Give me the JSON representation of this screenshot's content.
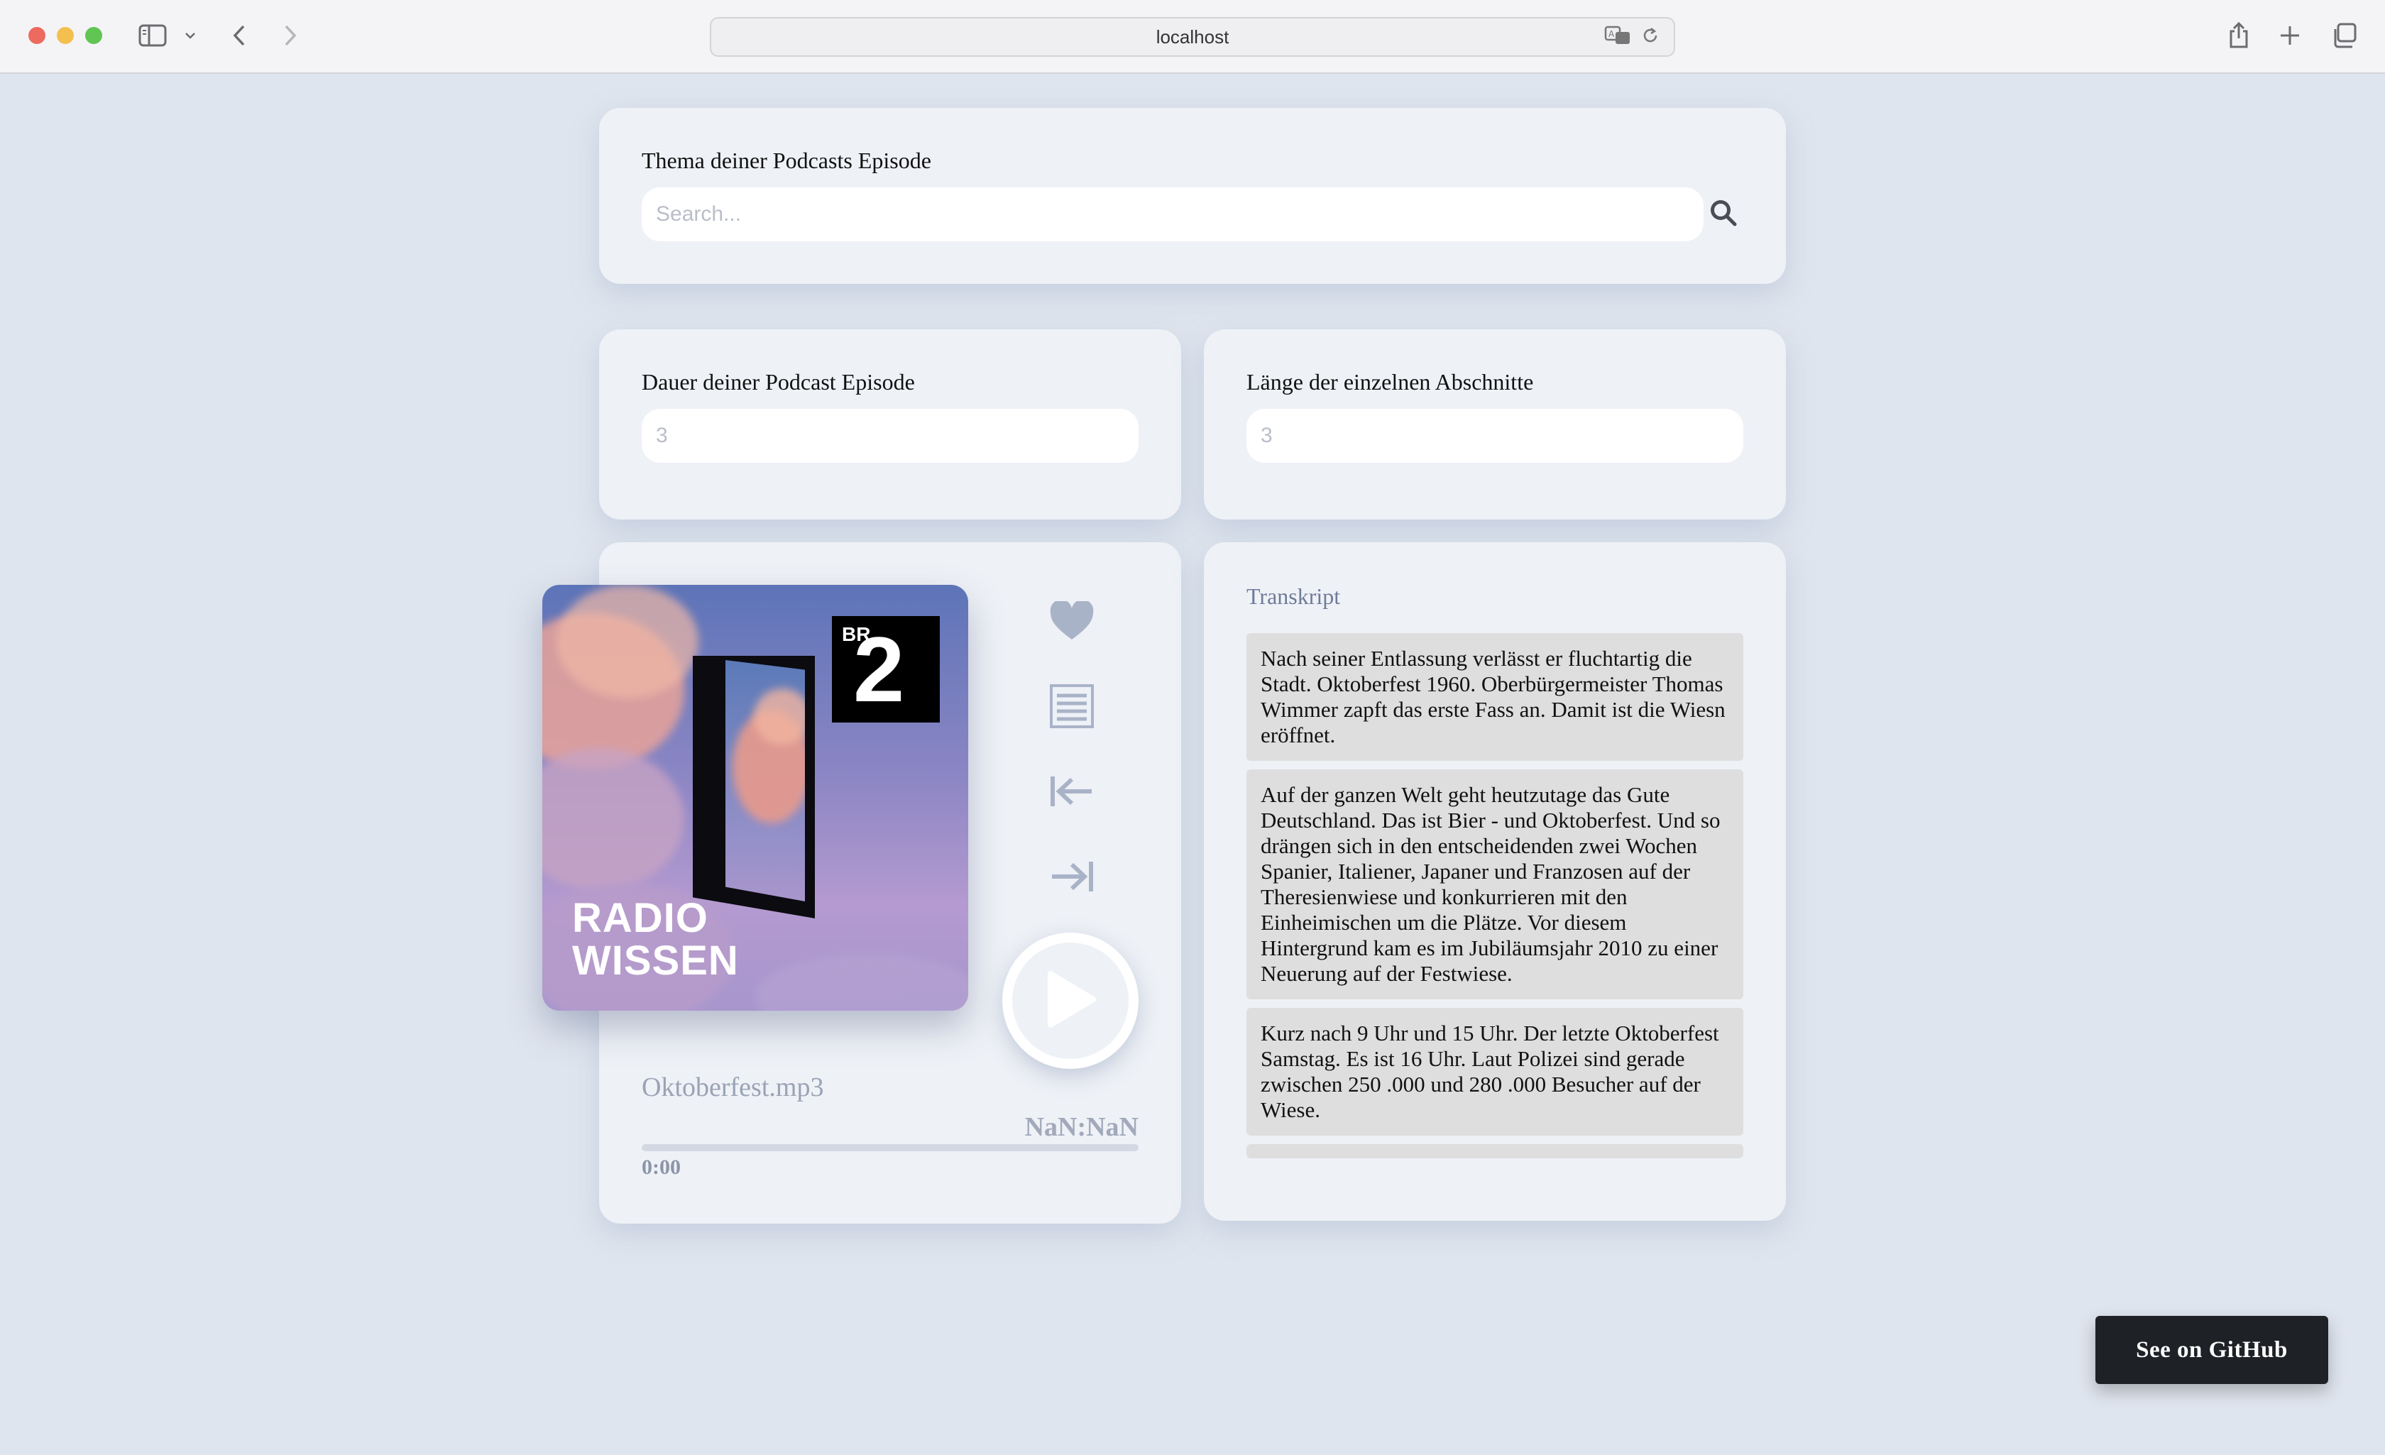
{
  "browser": {
    "url": "localhost"
  },
  "search": {
    "label": "Thema deiner Podcasts Episode",
    "placeholder": "Search..."
  },
  "duration": {
    "label": "Dauer deiner Podcast Episode",
    "placeholder": "3"
  },
  "segment_length": {
    "label": "Länge der einzelnen Abschnitte",
    "placeholder": "3"
  },
  "player": {
    "cover_logo_small": "BR",
    "cover_logo_big": "2",
    "cover_title_line1": "RADIO",
    "cover_title_line2": "WISSEN",
    "filename": "Oktoberfest.mp3",
    "total_time": "NaN:NaN",
    "current_time": "0:00",
    "progress": 0,
    "icons": [
      "heart-icon",
      "list-icon",
      "skip-back-icon",
      "skip-forward-icon",
      "play-icon"
    ]
  },
  "transcript": {
    "label": "Transkript",
    "blocks": [
      "Nach seiner Entlassung verlässt er fluchtartig die Stadt. Oktoberfest 1960. Oberbürgermeister Thomas Wimmer zapft das erste Fass an. Damit ist die Wiesn eröffnet.",
      "Auf der ganzen Welt geht heutzutage das Gute Deutschland. Das ist Bier - und Oktoberfest. Und so drängen sich in den entscheidenden zwei Wochen Spanier, Italiener, Japaner und Franzosen auf der Theresienwiese und konkurrieren mit den Einheimischen um die Plätze. Vor diesem Hintergrund kam es im Jubiläumsjahr 2010 zu einer Neuerung auf der Festwiese.",
      "Kurz nach 9 Uhr und 15 Uhr. Der letzte Oktoberfest Samstag. Es ist 16 Uhr. Laut Polizei sind gerade zwischen 250 .000 und 280 .000 Besucher auf der Wiese."
    ]
  },
  "github_button": "See on GitHub",
  "colors": {
    "page_bg": "#dfe5ee",
    "card_bg": "#eef1f6",
    "icon": "#a9b3c8",
    "github_bg": "#1e2126"
  }
}
